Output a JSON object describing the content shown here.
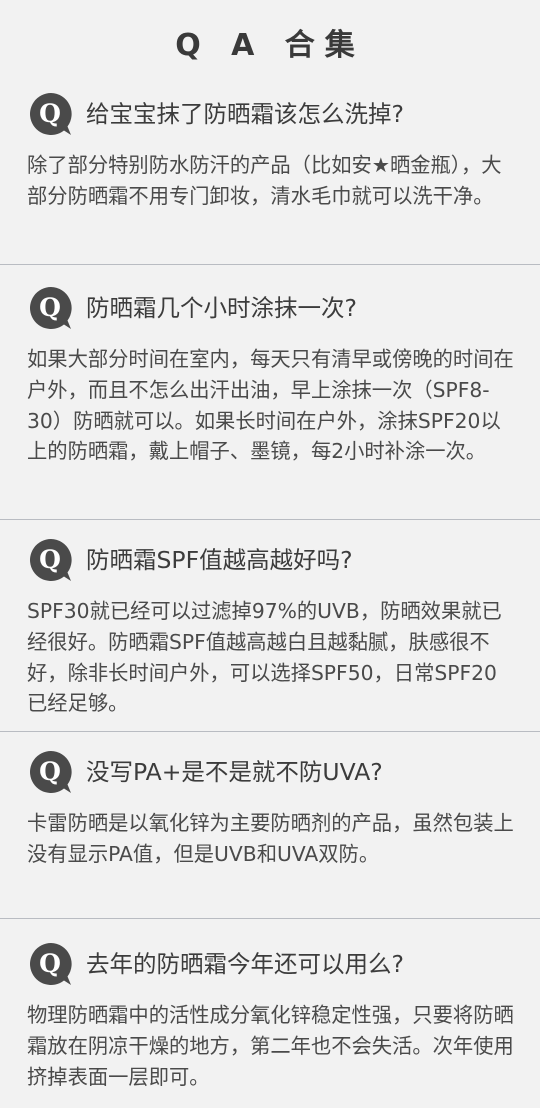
{
  "title": "Q A 合集",
  "icon": "q-bubble-icon",
  "colors": {
    "background": "#f2f2f2",
    "icon": "#4a4a4a",
    "divider": "#b9bcc2",
    "text": "#3d3d3d"
  },
  "qa": [
    {
      "question": "给宝宝抹了防晒霜该怎么洗掉?",
      "answer": "除了部分特别防水防汗的产品（比如安★晒金瓶），大部分防晒霜不用专门卸妆，清水毛巾就可以洗干净。"
    },
    {
      "question": "防晒霜几个小时涂抹一次?",
      "answer": "如果大部分时间在室内，每天只有清早或傍晚的时间在户外，而且不怎么出汗出油，早上涂抹一次（SPF8-30）防晒就可以。如果长时间在户外，涂抹SPF20以上的防晒霜，戴上帽子、墨镜，每2小时补涂一次。"
    },
    {
      "question": "防晒霜SPF值越高越好吗?",
      "answer": "SPF30就已经可以过滤掉97%的UVB，防晒效果就已经很好。防晒霜SPF值越高越白且越黏腻，肤感很不好，除非长时间户外，可以选择SPF50，日常SPF20已经足够。"
    },
    {
      "question": "没写PA+是不是就不防UVA?",
      "answer": "卡雷防晒是以氧化锌为主要防晒剂的产品，虽然包装上没有显示PA值，但是UVB和UVA双防。"
    },
    {
      "question": "去年的防晒霜今年还可以用么?",
      "answer": "物理防晒霜中的活性成分氧化锌稳定性强，只要将防晒霜放在阴凉干燥的地方，第二年也不会失活。次年使用挤掉表面一层即可。"
    }
  ]
}
